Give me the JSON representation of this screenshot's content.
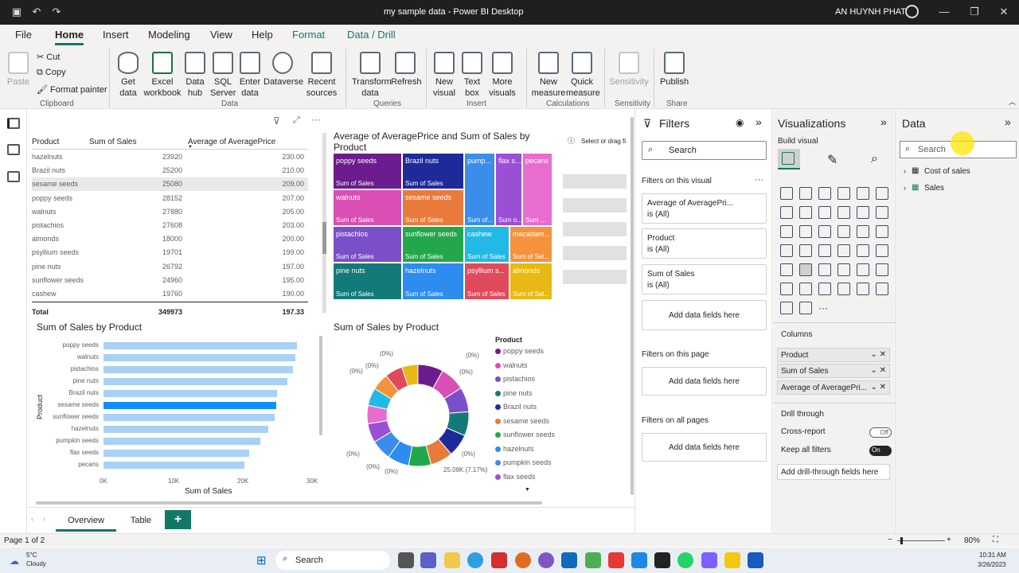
{
  "window": {
    "title": "my sample data - Power BI Desktop",
    "user": "AN HUYNH PHAT"
  },
  "tabs": [
    "File",
    "Home",
    "Insert",
    "Modeling",
    "View",
    "Help",
    "Format",
    "Data / Drill"
  ],
  "ribbon": {
    "clipboard": {
      "paste": "Paste",
      "cut": "Cut",
      "copy": "Copy",
      "format_painter": "Format painter",
      "group": "Clipboard"
    },
    "data": {
      "get_data": "Get data",
      "excel": "Excel workbook",
      "hub": "Data hub",
      "sql": "SQL Server",
      "enter": "Enter data",
      "dataverse": "Dataverse",
      "recent": "Recent sources",
      "group": "Data"
    },
    "queries": {
      "transform": "Transform data",
      "refresh": "Refresh",
      "group": "Queries"
    },
    "insert": {
      "new_visual": "New visual",
      "text_box": "Text box",
      "more_visuals": "More visuals",
      "group": "Insert"
    },
    "calculations": {
      "new_measure": "New measure",
      "quick_measure": "Quick measure",
      "group": "Calculations"
    },
    "sensitivity": {
      "label": "Sensitivity",
      "group": "Sensitivity"
    },
    "share": {
      "publish": "Publish",
      "group": "Share"
    }
  },
  "table": {
    "headers": [
      "Product",
      "Sum of Sales",
      "Average of AveragePrice"
    ],
    "rows": [
      [
        "hazelnuts",
        "23920",
        "230.00"
      ],
      [
        "Brazil nuts",
        "25200",
        "210.00"
      ],
      [
        "sesame seeds",
        "25080",
        "209.00"
      ],
      [
        "poppy seeds",
        "28152",
        "207.00"
      ],
      [
        "walnuts",
        "27880",
        "205.00"
      ],
      [
        "pistachios",
        "27608",
        "203.00"
      ],
      [
        "almonds",
        "18000",
        "200.00"
      ],
      [
        "psyllium seeds",
        "19701",
        "199.00"
      ],
      [
        "pine nuts",
        "26792",
        "197.00"
      ],
      [
        "sunflower seeds",
        "24960",
        "195.00"
      ],
      [
        "cashew",
        "19760",
        "190.00"
      ]
    ],
    "total": [
      "Total",
      "349973",
      "197.33"
    ]
  },
  "treemap": {
    "title": "Average of AveragePrice and Sum of Sales by Product",
    "select_hint": "Select or drag fi",
    "tiles": [
      {
        "label": "poppy seeds",
        "sub": "Sum of Sales",
        "color": "#6b1c8e"
      },
      {
        "label": "Brazil nuts",
        "sub": "Sum of Sales",
        "color": "#1f2a9a"
      },
      {
        "label": "pump...",
        "sub": "Sum of...",
        "color": "#3a8eea"
      },
      {
        "label": "flax s...",
        "sub": "Sum o...",
        "color": "#9b4fd6"
      },
      {
        "label": "pecans",
        "sub": "Sum ...",
        "color": "#e86dce"
      },
      {
        "label": "walnuts",
        "sub": "Sum of Sales",
        "color": "#d94fb3"
      },
      {
        "label": "sesame seeds",
        "sub": "Sum of Sales",
        "color": "#ea7a3c"
      },
      {
        "label": "pistachios",
        "sub": "Sum of Sales",
        "color": "#7a4fc8"
      },
      {
        "label": "sunflower seeds",
        "sub": "Sum of Sales",
        "color": "#22a84a"
      },
      {
        "label": "cashew",
        "sub": "Sum of Sales",
        "color": "#21b9e6"
      },
      {
        "label": "macadam...",
        "sub": "Sum of Sal...",
        "color": "#f5923e"
      },
      {
        "label": "pine nuts",
        "sub": "Sum of Sales",
        "color": "#137a7a"
      },
      {
        "label": "hazelnuts",
        "sub": "Sum of Sales",
        "color": "#2d8cf0"
      },
      {
        "label": "psyllium s...",
        "sub": "Sum of Sales",
        "color": "#e04a5c"
      },
      {
        "label": "almonds",
        "sub": "Sum of Sal...",
        "color": "#e8b914"
      }
    ]
  },
  "bar_chart": {
    "title": "Sum of Sales by Product",
    "xlabel": "Sum of Sales",
    "ylabel": "Product",
    "ticks": [
      "0K",
      "10K",
      "20K",
      "30K"
    ]
  },
  "donut": {
    "title": "Sum of Sales by Product",
    "legend_title": "Product",
    "callout": "25.08K (7.17%)",
    "pct": "(0%)",
    "legend": [
      {
        "name": "poppy seeds",
        "color": "#6b1c8e"
      },
      {
        "name": "walnuts",
        "color": "#d94fb3"
      },
      {
        "name": "pistachios",
        "color": "#7a4fc8"
      },
      {
        "name": "pine nuts",
        "color": "#137a7a"
      },
      {
        "name": "Brazil nuts",
        "color": "#1f2a9a"
      },
      {
        "name": "sesame seeds",
        "color": "#ea7a3c"
      },
      {
        "name": "sunflower seeds",
        "color": "#22a84a"
      },
      {
        "name": "hazelnuts",
        "color": "#2d8cf0"
      },
      {
        "name": "pumpkin seeds",
        "color": "#3a8eea"
      },
      {
        "name": "flax seeds",
        "color": "#9b4fd6"
      }
    ]
  },
  "chart_data": [
    {
      "type": "table",
      "title": "",
      "columns": [
        "Product",
        "Sum of Sales",
        "Average of AveragePrice"
      ],
      "rows": [
        [
          "hazelnuts",
          23920,
          230.0
        ],
        [
          "Brazil nuts",
          25200,
          210.0
        ],
        [
          "sesame seeds",
          25080,
          209.0
        ],
        [
          "poppy seeds",
          28152,
          207.0
        ],
        [
          "walnuts",
          27880,
          205.0
        ],
        [
          "pistachios",
          27608,
          203.0
        ],
        [
          "almonds",
          18000,
          200.0
        ],
        [
          "psyllium seeds",
          19701,
          199.0
        ],
        [
          "pine nuts",
          26792,
          197.0
        ],
        [
          "sunflower seeds",
          24960,
          195.0
        ],
        [
          "cashew",
          19760,
          190.0
        ]
      ],
      "total": [
        349973,
        197.33
      ]
    },
    {
      "type": "bar",
      "title": "Sum of Sales by Product",
      "xlabel": "Sum of Sales",
      "ylabel": "Product",
      "xlim": [
        0,
        30000
      ],
      "categories": [
        "poppy seeds",
        "walnuts",
        "pistachios",
        "pine nuts",
        "Brazil nuts",
        "sesame seeds",
        "sunflower seeds",
        "hazelnuts",
        "pumpkin seeds",
        "flax seeds",
        "pecans"
      ],
      "values": [
        28152,
        27880,
        27608,
        26792,
        25200,
        25080,
        24960,
        23920,
        22800,
        21200,
        20500
      ],
      "highlight": "sesame seeds"
    },
    {
      "type": "pie",
      "title": "Sum of Sales by Product",
      "legend_title": "Product",
      "categories": [
        "poppy seeds",
        "walnuts",
        "pistachios",
        "pine nuts",
        "Brazil nuts",
        "sesame seeds",
        "sunflower seeds",
        "hazelnuts",
        "pumpkin seeds",
        "flax seeds",
        "pecans",
        "cashew",
        "macadamia",
        "psyllium seeds",
        "almonds"
      ],
      "values": [
        28152,
        27880,
        27608,
        26792,
        25200,
        25080,
        24960,
        23920,
        22800,
        21200,
        20500,
        19760,
        19000,
        19701,
        18000
      ]
    }
  ],
  "filters": {
    "title": "Filters",
    "search": "Search",
    "on_visual": "Filters on this visual",
    "cards": [
      {
        "name": "Average of AveragePri...",
        "state": "is (All)"
      },
      {
        "name": "Product",
        "state": "is (All)"
      },
      {
        "name": "Sum of Sales",
        "state": "is (All)"
      }
    ],
    "add": "Add data fields here",
    "on_page": "Filters on this page",
    "on_all": "Filters on all pages"
  },
  "viz": {
    "title": "Visualizations",
    "build": "Build visual",
    "columns": "Columns",
    "wells": [
      "Product",
      "Sum of Sales",
      "Average of AveragePri..."
    ],
    "drill": "Drill through",
    "cross": "Cross-report",
    "cross_state": "Off",
    "keep": "Keep all filters",
    "keep_state": "On",
    "add_drill": "Add drill-through fields here",
    "more": "···"
  },
  "data": {
    "title": "Data",
    "search": "Search",
    "items": [
      "Cost of sales",
      "Sales"
    ]
  },
  "pages": {
    "overview": "Overview",
    "table": "Table",
    "add": "+"
  },
  "status": {
    "page": "Page 1 of 2",
    "zoom": "80%"
  },
  "taskbar": {
    "temp": "5°C",
    "weather": "Cloudy",
    "search": "Search",
    "time": "10:31 AM",
    "date": "3/26/2023"
  }
}
